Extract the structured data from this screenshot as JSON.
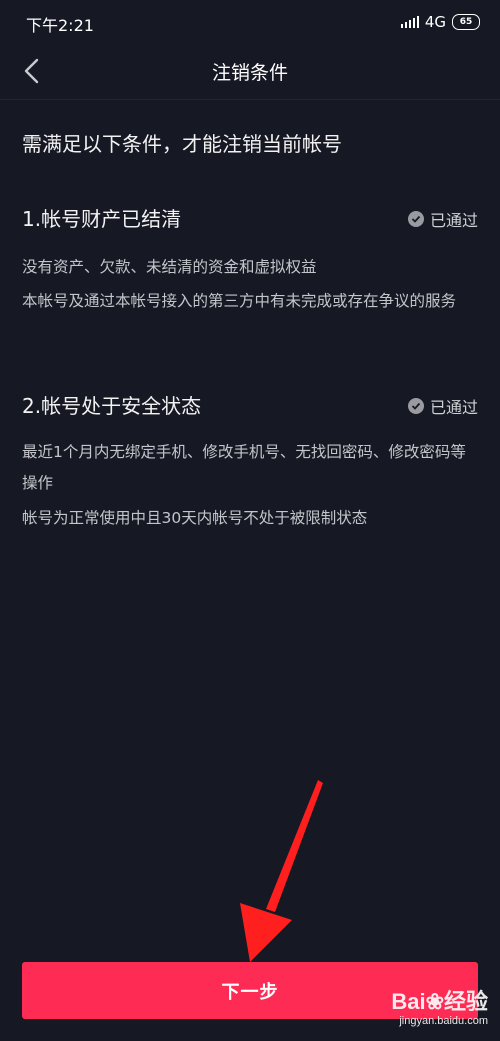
{
  "status_bar": {
    "time": "下午2:21",
    "network": "4G",
    "battery": "65"
  },
  "nav": {
    "title": "注销条件",
    "back_icon": "chevron-left-icon"
  },
  "intro": "需满足以下条件，才能注销当前帐号",
  "conditions": [
    {
      "title": "1.帐号财产已结清",
      "status": "已通过",
      "descriptions": [
        "没有资产、欠款、未结清的资金和虚拟权益",
        "本帐号及通过本帐号接入的第三方中有未完成或存在争议的服务"
      ]
    },
    {
      "title": "2.帐号处于安全状态",
      "status": "已通过",
      "descriptions": [
        "最近1个月内无绑定手机、修改手机号、无找回密码、修改密码等操作",
        "帐号为正常使用中且30天内帐号不处于被限制状态"
      ]
    }
  ],
  "next_button": "下一步",
  "watermark": {
    "brand": "Bai❀经验",
    "url": "jingyan.baidu.com"
  },
  "colors": {
    "background": "#161823",
    "accent": "#fe2c55",
    "annotation_arrow": "#ff1f1f"
  }
}
